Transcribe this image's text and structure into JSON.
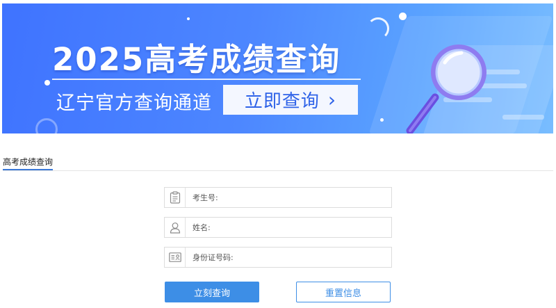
{
  "banner": {
    "title": "2025高考成绩查询",
    "subtitle": "辽宁官方查询通道",
    "cta_label": "立即查询",
    "cta_icon": "chevron-right-icon",
    "colors": {
      "background": "#4d87ff",
      "cta_text": "#2f63e8"
    }
  },
  "tabs": [
    {
      "label": "高考成绩查询",
      "active": true
    }
  ],
  "form": {
    "fields": [
      {
        "label": "考生号:",
        "icon": "clipboard-icon",
        "value": ""
      },
      {
        "label": "姓名:",
        "icon": "user-icon",
        "value": ""
      },
      {
        "label": "身份证号码:",
        "icon": "id-card-icon",
        "value": ""
      }
    ],
    "submit_label": "立刻查询",
    "reset_label": "重置信息"
  },
  "colors": {
    "accent": "#3d8ee6",
    "tab_underline": "#3a78d8"
  }
}
